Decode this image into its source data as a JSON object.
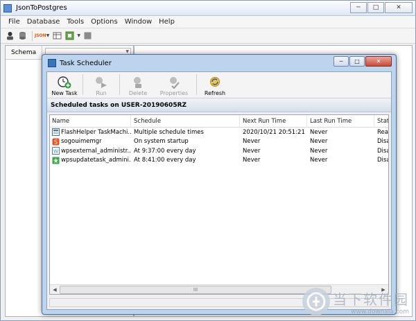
{
  "main": {
    "title": "JsonToPostgres",
    "win_buttons": {
      "minimize": "─",
      "maximize": "□",
      "close": "✕"
    },
    "menu": [
      "File",
      "Database",
      "Tools",
      "Options",
      "Window",
      "Help"
    ],
    "toolbar": {
      "json_label": "JSON"
    },
    "schema": {
      "tab_label": "Schema"
    }
  },
  "dialog": {
    "title": "Task Scheduler",
    "win_buttons": {
      "minimize": "─",
      "maximize": "□",
      "close": "✕"
    },
    "toolbar": [
      {
        "label": "New Task",
        "enabled": true,
        "icon": "clock-plus-icon"
      },
      {
        "label": "Run",
        "enabled": false,
        "icon": "run-arrow-icon"
      },
      {
        "label": "Delete",
        "enabled": false,
        "icon": "delete-icon"
      },
      {
        "label": "Properties",
        "enabled": false,
        "icon": "properties-icon"
      },
      {
        "label": "Refresh",
        "enabled": true,
        "icon": "refresh-icon"
      }
    ],
    "header_text": "Scheduled tasks on USER-20190605RZ",
    "columns": [
      "Name",
      "Schedule",
      "Next Run Time",
      "Last Run Time",
      "Status"
    ],
    "rows": [
      {
        "name": "FlashHelper TaskMachi...",
        "schedule": "Multiple schedule times",
        "next": "2020/10/21 20:51:21",
        "last": "Never",
        "status": "Read",
        "icon_color": "#3a6fc4"
      },
      {
        "name": "sogouimemgr",
        "schedule": "On system startup",
        "next": "Never",
        "last": "Never",
        "status": "Disab",
        "icon_color": "#e8531f"
      },
      {
        "name": "wpsexternal_administr...",
        "schedule": "At 9:37:00 every day",
        "next": "Never",
        "last": "Never",
        "status": "Disab",
        "icon_color": "#4a7fd4"
      },
      {
        "name": "wpsupdatetask_admini...",
        "schedule": "At 8:41:00 every day",
        "next": "Never",
        "last": "Never",
        "status": "Disab",
        "icon_color": "#3aa844"
      }
    ],
    "scroll_grip": "III"
  },
  "watermark": {
    "cn": "当下软件园",
    "url": "www.downxia.com"
  }
}
